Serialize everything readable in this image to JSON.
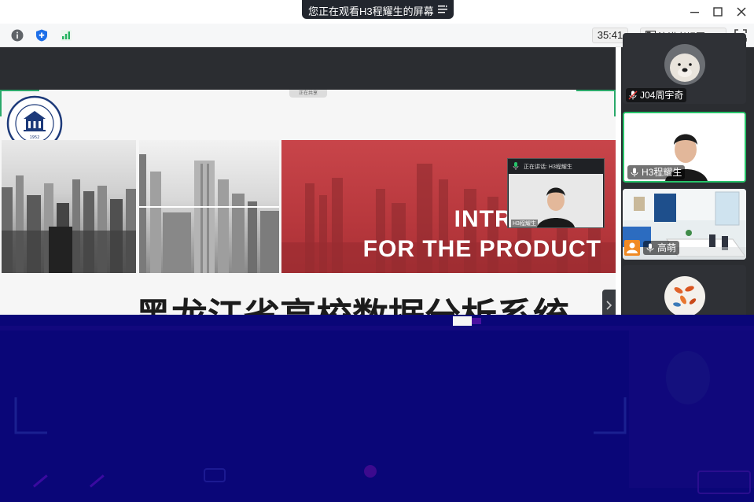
{
  "window": {
    "share_banner": "您正在观看H3程耀生的屏幕"
  },
  "toolbar": {
    "timer": "35:41",
    "view_mode": "演讲者视图"
  },
  "slide": {
    "heading_line1": "INTRODUCE",
    "heading_line2": "FOR THE PRODUCT",
    "title": "黑龙江省高校数据分析系统",
    "sharing_tag": "正在共享",
    "pip_header": "正在讲话: H3程耀生",
    "pip_name": "H3程耀生"
  },
  "participants": [
    {
      "name": "J04周宇奇",
      "mic": "muted",
      "avatar_icon": "dog-avatar-icon"
    },
    {
      "name": "H3程耀生",
      "mic": "on",
      "active_speaker": true
    },
    {
      "name": "高萌",
      "mic": "on",
      "avatar_icon": "person-icon"
    },
    {
      "name": "",
      "avatar_icon": "fish-avatar-icon"
    }
  ],
  "colors": {
    "accent_green": "#27c46a",
    "slide_red": "#b8383d",
    "glitch_blue": "#0a0678",
    "banner_dark": "#22262e"
  }
}
